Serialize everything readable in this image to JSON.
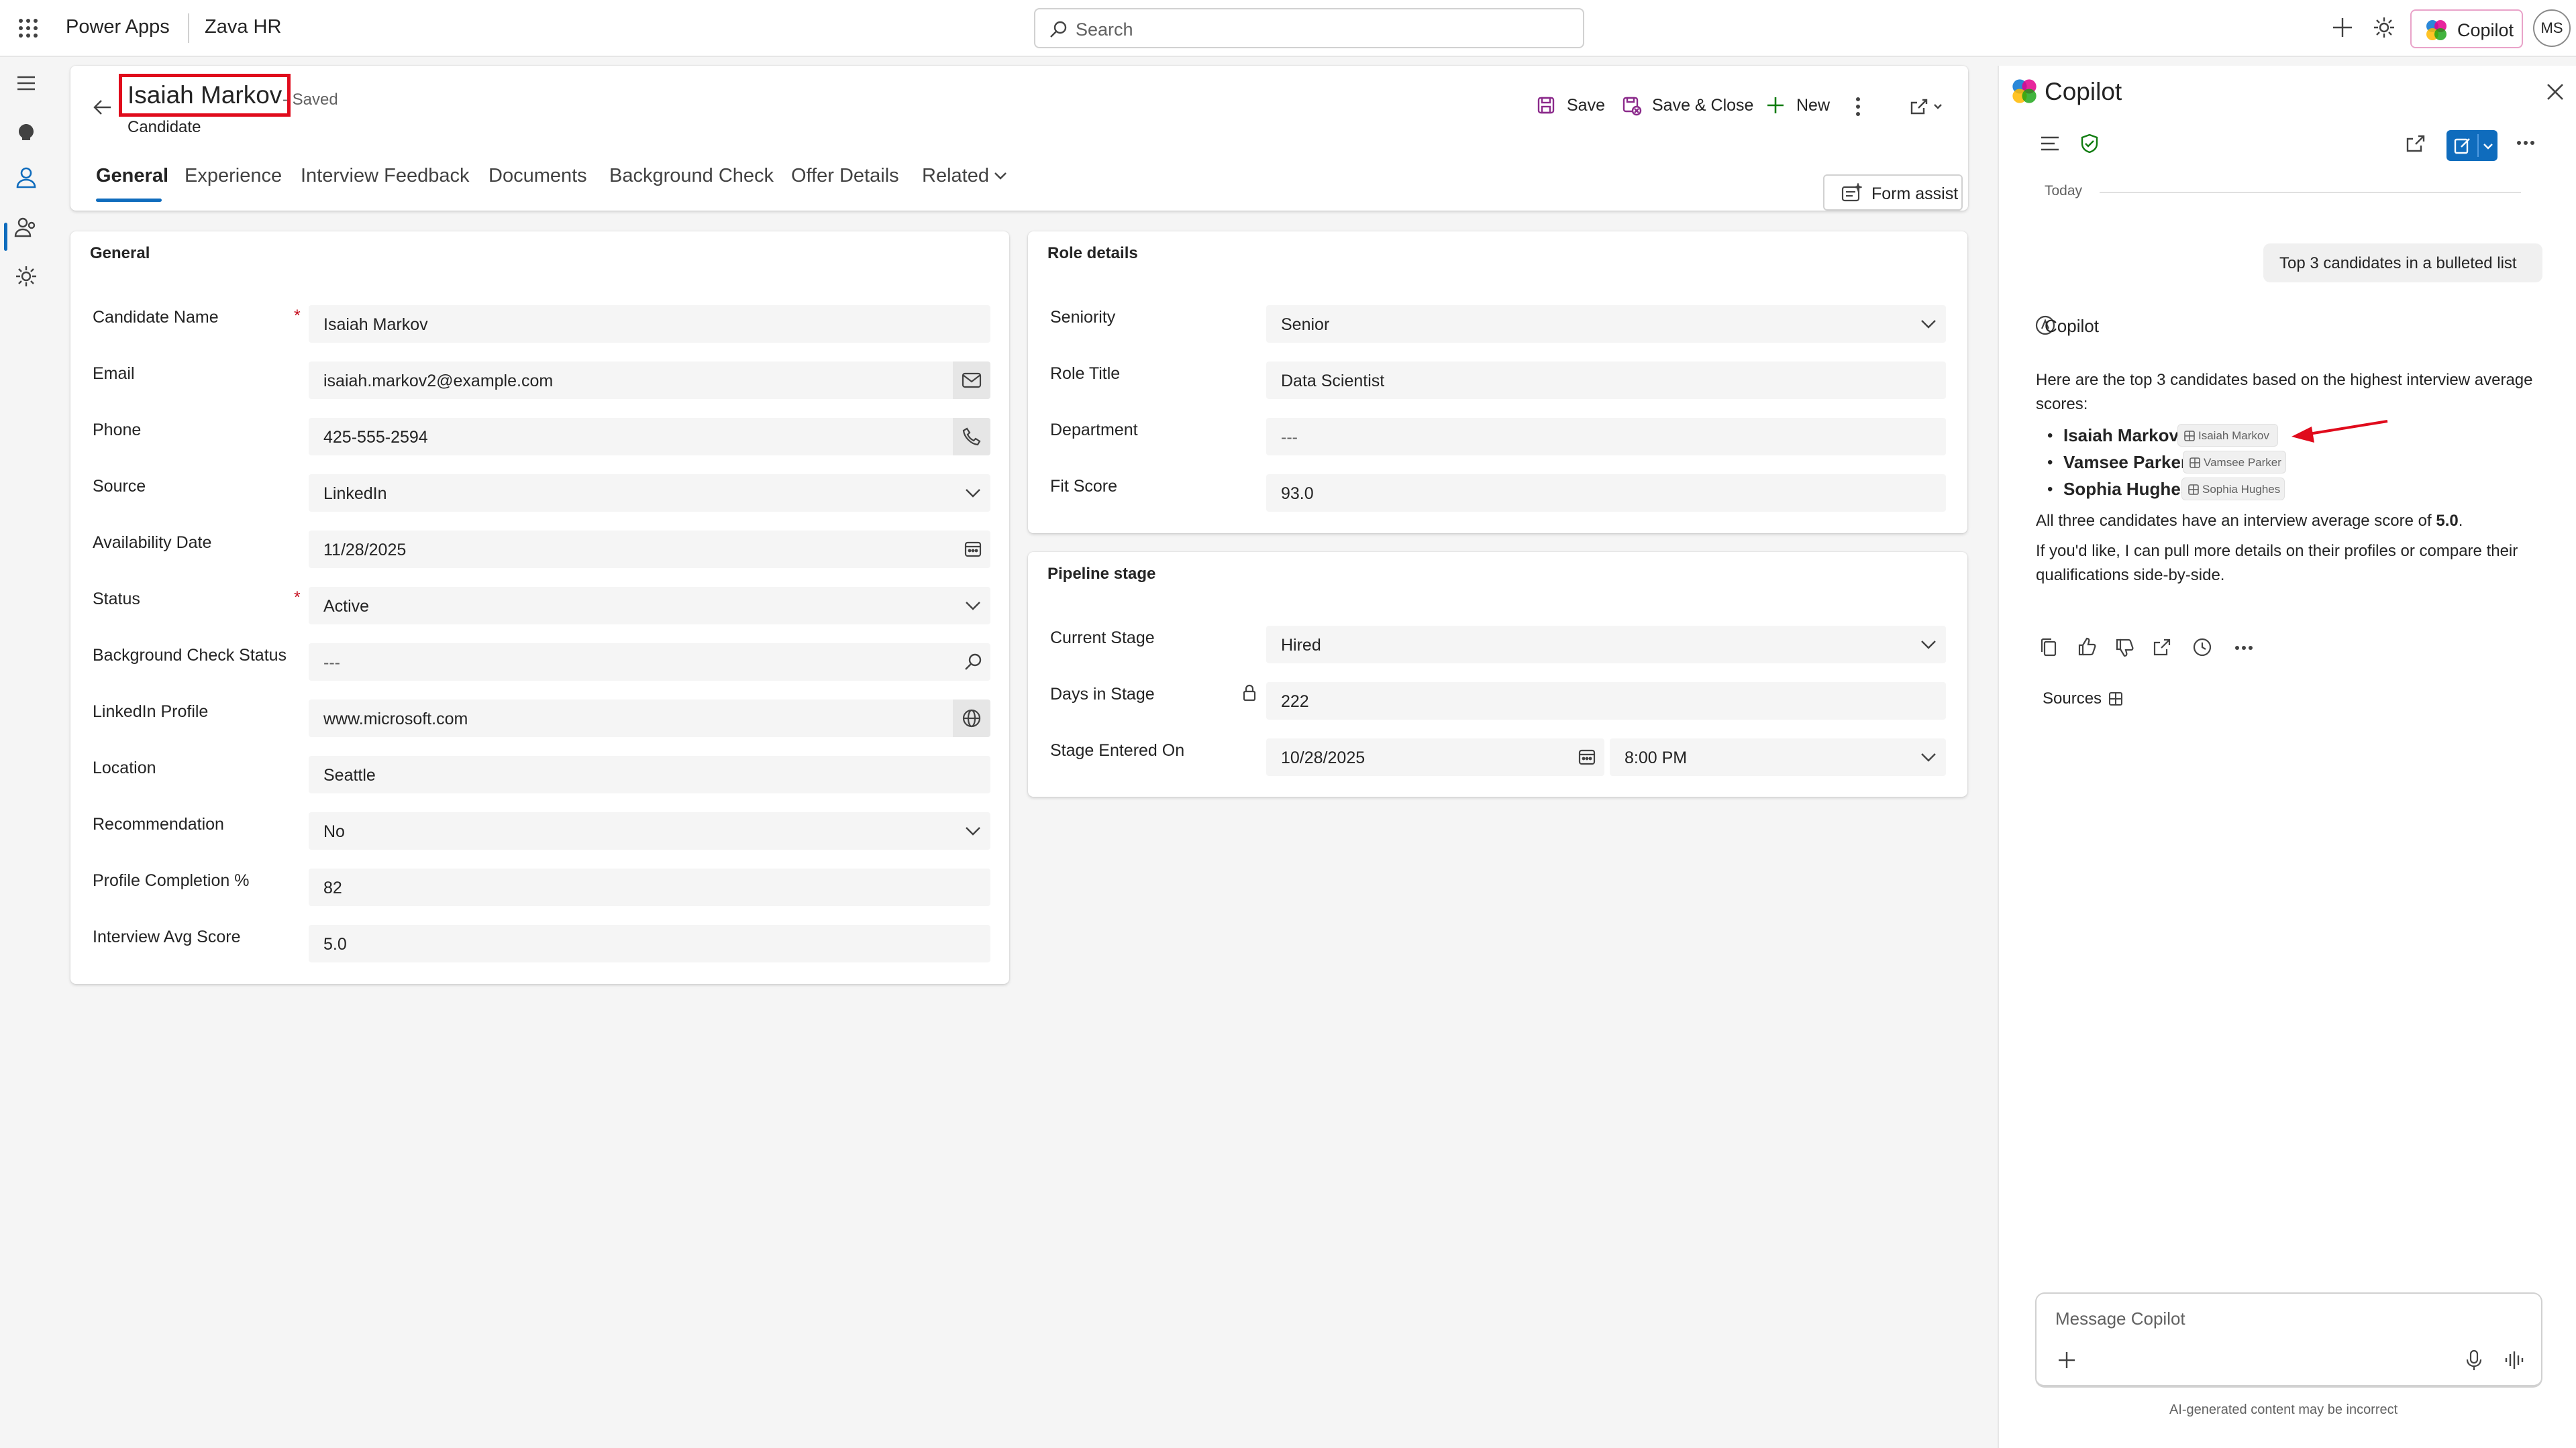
{
  "topbar": {
    "app_name": "Power Apps",
    "env_name": "Zava HR",
    "search_placeholder": "Search",
    "copilot_label": "Copilot",
    "avatar_initials": "MS"
  },
  "record": {
    "title": "Isaiah Markov",
    "saved_status": "- Saved",
    "entity": "Candidate"
  },
  "commands": {
    "save": "Save",
    "save_close": "Save & Close",
    "new": "New"
  },
  "tabs": [
    "General",
    "Experience",
    "Interview Feedback",
    "Documents",
    "Background Check",
    "Offer Details",
    "Related"
  ],
  "form_assist": "Form assist",
  "general": {
    "title": "General",
    "fields": [
      {
        "label": "Candidate Name",
        "value": "Isaiah Markov"
      },
      {
        "label": "Email",
        "value": "isaiah.markov2@example.com"
      },
      {
        "label": "Phone",
        "value": "425-555-2594"
      },
      {
        "label": "Source",
        "value": "LinkedIn"
      },
      {
        "label": "Availability Date",
        "value": "11/28/2025"
      },
      {
        "label": "Status",
        "value": "Active"
      },
      {
        "label": "Background Check Status",
        "value": "---"
      },
      {
        "label": "LinkedIn Profile",
        "value": "www.microsoft.com"
      },
      {
        "label": "Location",
        "value": "Seattle"
      },
      {
        "label": "Recommendation",
        "value": "No"
      },
      {
        "label": "Profile Completion %",
        "value": "82"
      },
      {
        "label": "Interview Avg Score",
        "value": "5.0"
      }
    ]
  },
  "role": {
    "title": "Role details",
    "fields": [
      {
        "label": "Seniority",
        "value": "Senior"
      },
      {
        "label": "Role Title",
        "value": "Data Scientist"
      },
      {
        "label": "Department",
        "value": "---"
      },
      {
        "label": "Fit Score",
        "value": "93.0"
      }
    ]
  },
  "pipeline": {
    "title": "Pipeline stage",
    "fields": [
      {
        "label": "Current Stage",
        "value": "Hired"
      },
      {
        "label": "Days in Stage",
        "value": "222"
      },
      {
        "label": "Stage Entered On",
        "value": "10/28/2025",
        "value2": "8:00 PM"
      }
    ]
  },
  "copilot": {
    "title": "Copilot",
    "today": "Today",
    "user_message": "Top 3 candidates in a bulleted list",
    "author": "Copilot",
    "intro": "Here are the top 3 candidates based on the highest interview average scores:",
    "candidates": [
      {
        "name": "Isaiah Markov",
        "chip": "Isaiah Markov"
      },
      {
        "name": "Vamsee Parker",
        "chip": "Vamsee Parker"
      },
      {
        "name": "Sophia Hughes",
        "chip": "Sophia Hughes"
      }
    ],
    "summary_pre": "All three candidates have an interview average score of ",
    "summary_bold": "5.0",
    "summary_post": ".",
    "followup": "If you'd like, I can pull more details on their profiles or compare their qualifications side-by-side.",
    "sources": "Sources",
    "input_placeholder": "Message Copilot",
    "disclaimer": "AI-generated content may be incorrect"
  },
  "colors": {
    "accent": "#0f6cbd",
    "highlight_box": "#e00b1c",
    "annotation_arrow": "#e00b1c",
    "save_icon": "#8b2a8b"
  }
}
